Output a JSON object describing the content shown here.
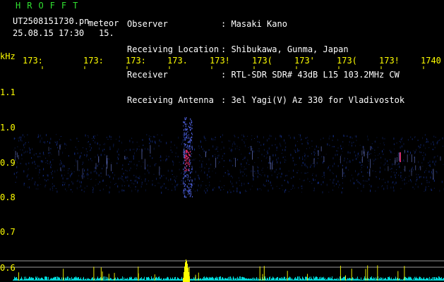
{
  "header": {
    "logo": "HROFFT",
    "file_name": "UT2508151730.pn",
    "file_suffix": "meteor",
    "date_time": "25.08.15 17:30",
    "count": "15."
  },
  "info": {
    "labels": [
      "Observer",
      "Receiving Location",
      "Receiver",
      "Receiving Antenna"
    ],
    "values": [
      ": Masaki Kano",
      ": Shibukawa, Gunma, Japan",
      ": RTL-SDR SDR# 43dB L15 103.2MHz CW",
      ": 3el Yagi(V) Az 330 for Vladivostok"
    ]
  },
  "freq_axis": {
    "ticks": [
      "173:",
      "173:",
      "173:",
      "173.",
      "173!",
      "173(",
      "173'",
      "173(",
      "173!",
      "1740"
    ]
  },
  "y_axis": {
    "unit": "kHz",
    "ticks": [
      "1.1",
      "1.0",
      "0.9",
      "0.8",
      "0.7",
      "0.6"
    ]
  },
  "colors": {
    "axis": "#ffff00",
    "logo": "#30e030",
    "noise": "#1a3aaa",
    "echo_core": "#ff2a6a",
    "baseline": "#00ffff",
    "peak": "#ffff00"
  }
}
